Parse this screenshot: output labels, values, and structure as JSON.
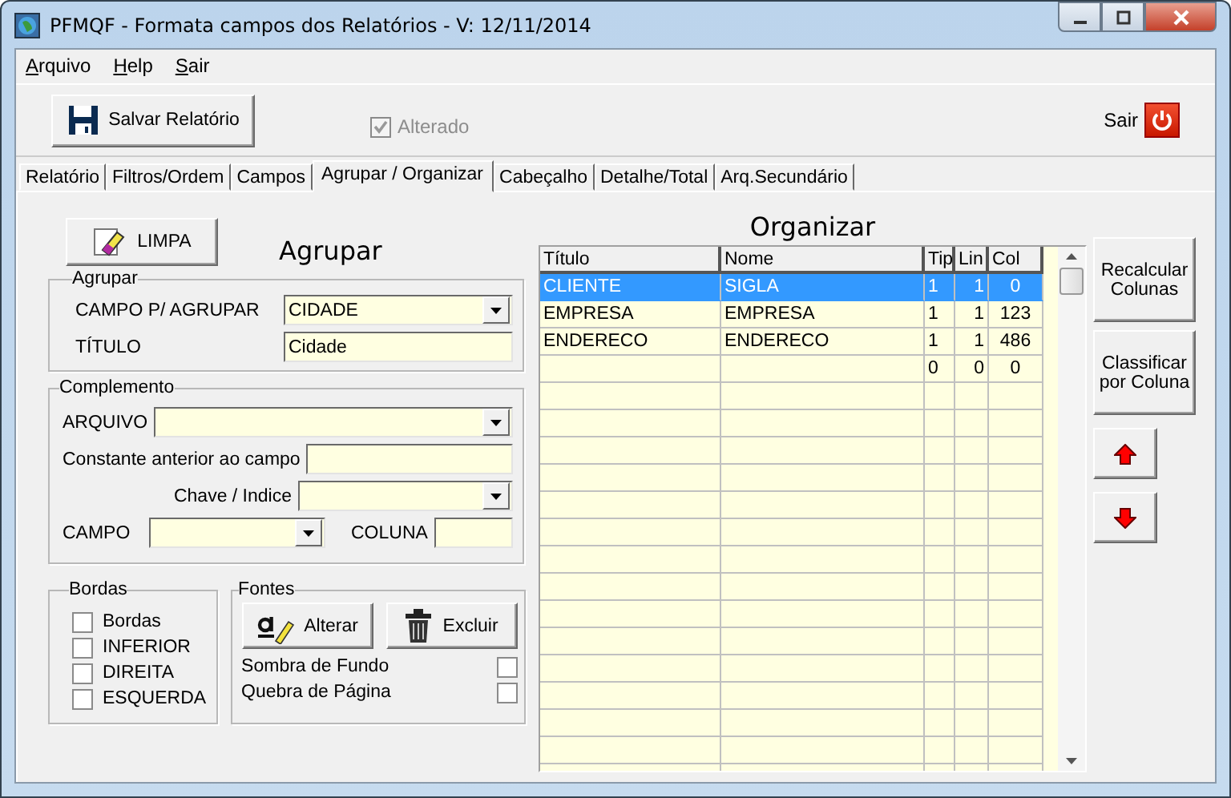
{
  "window": {
    "title": "PFMQF - Formata campos dos Relatórios - V: 12/11/2014"
  },
  "menu": [
    "Arquivo",
    "Help",
    "Sair"
  ],
  "toolbar": {
    "save_button": "Salvar Relatório",
    "altered": {
      "label": "Alterado",
      "checked": true,
      "disabled": true
    },
    "exit_label": "Sair"
  },
  "tabs": [
    {
      "label": "Relatório",
      "selected": false
    },
    {
      "label": "Filtros/Ordem",
      "selected": false
    },
    {
      "label": "Campos",
      "selected": false
    },
    {
      "label": "Agrupar / Organizar",
      "selected": true
    },
    {
      "label": "Cabeçalho",
      "selected": false
    },
    {
      "label": "Detalhe/Total",
      "selected": false
    },
    {
      "label": "Arq.Secundário",
      "selected": false
    }
  ],
  "clear_button": "LIMPA",
  "group_heading": "Agrupar",
  "agrupar": {
    "legend": "Agrupar",
    "field_label": "CAMPO P/ AGRUPAR",
    "field_value": "CIDADE",
    "title_label": "TÍTULO",
    "title_value": "Cidade"
  },
  "complemento": {
    "legend": "Complemento",
    "arquivo_label": "ARQUIVO",
    "constante_label": "Constante anterior ao campo",
    "chave_label": "Chave / Indice",
    "campo_label": "CAMPO",
    "coluna_label": "COLUNA"
  },
  "bordas": {
    "legend": "Bordas",
    "items": [
      {
        "label": "Bordas",
        "checked": false
      },
      {
        "label": "INFERIOR",
        "checked": false
      },
      {
        "label": "DIREITA",
        "checked": false
      },
      {
        "label": "ESQUERDA",
        "checked": false
      }
    ]
  },
  "fontes": {
    "legend": "Fontes",
    "alter_button": "Alterar",
    "delete_button": "Excluir",
    "options": [
      {
        "label": "Sombra de Fundo",
        "checked": false
      },
      {
        "label": "Quebra de Página",
        "checked": false
      }
    ]
  },
  "organize_heading": "Organizar",
  "table": {
    "columns": [
      "Título",
      "Nome",
      "Tip",
      "Lin",
      "Col"
    ],
    "rows": [
      {
        "cells": [
          "CLIENTE",
          "SIGLA",
          "1",
          "1",
          "0"
        ],
        "selected": true
      },
      {
        "cells": [
          "EMPRESA",
          "EMPRESA",
          "1",
          "1",
          "123"
        ],
        "selected": false
      },
      {
        "cells": [
          "ENDERECO",
          "ENDERECO",
          "1",
          "1",
          "486"
        ],
        "selected": false
      },
      {
        "cells": [
          null,
          null,
          "0",
          "0",
          "0"
        ],
        "selected": false
      }
    ]
  },
  "side_buttons": [
    "Recalcular Colunas",
    "Classificar por Coluna"
  ]
}
